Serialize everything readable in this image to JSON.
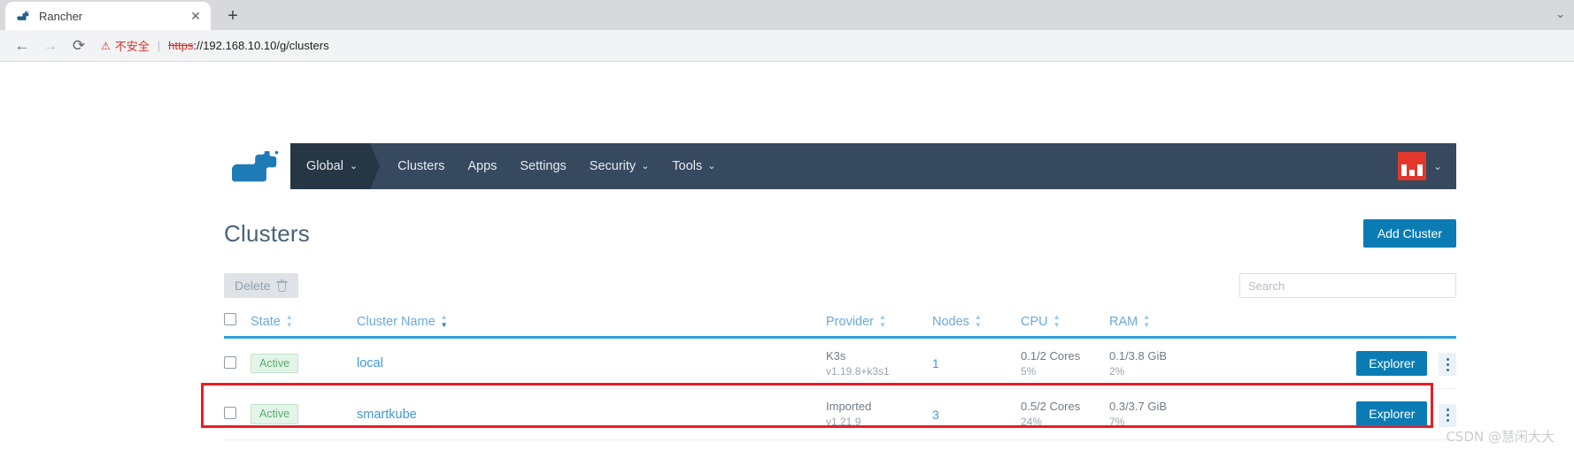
{
  "browser": {
    "tab": {
      "title": "Rancher",
      "favicon_name": "rancher-favicon",
      "close_label": "✕"
    },
    "new_tab_label": "+",
    "window_controls_label": "⌄",
    "nav": {
      "back": "←",
      "forward": "→",
      "reload": "⟳"
    },
    "omnibox": {
      "warning_icon": "⚠",
      "warning_text": "不安全",
      "separator": "|",
      "url_scheme": "https",
      "url_rest": "://192.168.10.10/g/clusters"
    }
  },
  "rancher": {
    "logo_name": "rancher-logo",
    "nav": {
      "global_label": "Global",
      "global_chevron": "⌄",
      "items": [
        {
          "label": "Clusters",
          "has_chevron": false
        },
        {
          "label": "Apps",
          "has_chevron": false
        },
        {
          "label": "Settings",
          "has_chevron": false
        },
        {
          "label": "Security",
          "has_chevron": true
        },
        {
          "label": "Tools",
          "has_chevron": true
        }
      ],
      "chevron": "⌄",
      "avatar_name": "user-avatar",
      "avatar_chevron": "⌄"
    },
    "page_title": "Clusters",
    "add_cluster_label": "Add Cluster",
    "toolbar": {
      "delete_label": "Delete",
      "delete_icon": "🗑",
      "search_placeholder": "Search",
      "search_value": ""
    },
    "table": {
      "columns": [
        {
          "key": "state",
          "label": "State",
          "sorted": false
        },
        {
          "key": "name",
          "label": "Cluster Name",
          "sorted": true
        },
        {
          "key": "provider",
          "label": "Provider",
          "sorted": false
        },
        {
          "key": "nodes",
          "label": "Nodes",
          "sorted": false
        },
        {
          "key": "cpu",
          "label": "CPU",
          "sorted": false
        },
        {
          "key": "ram",
          "label": "RAM",
          "sorted": false
        }
      ],
      "rows": [
        {
          "state": "Active",
          "name": "local",
          "provider": "K3s",
          "version": "v1.19.8+k3s1",
          "nodes": "1",
          "cpu": "0.1/2 Cores",
          "cpu_pct": "5%",
          "ram": "0.1/3.8 GiB",
          "ram_pct": "2%",
          "action_label": "Explorer",
          "highlighted": false
        },
        {
          "state": "Active",
          "name": "smartkube",
          "provider": "Imported",
          "version": "v1.21.9",
          "nodes": "3",
          "cpu": "0.5/2 Cores",
          "cpu_pct": "24%",
          "ram": "0.3/3.7 GiB",
          "ram_pct": "7%",
          "action_label": "Explorer",
          "highlighted": true
        }
      ]
    }
  },
  "watermark": "CSDN @慧闲大大",
  "colors": {
    "nav_bg": "#37495e",
    "nav_active_bg": "#263644",
    "primary": "#0b7cb3",
    "link": "#3d98d6",
    "header_underline": "#2da0e0",
    "badge_text": "#5aab6f",
    "badge_bg": "#e3f5e8",
    "highlight": "#ec1c24",
    "avatar_bg": "#e2372b",
    "warning": "#d93025"
  }
}
